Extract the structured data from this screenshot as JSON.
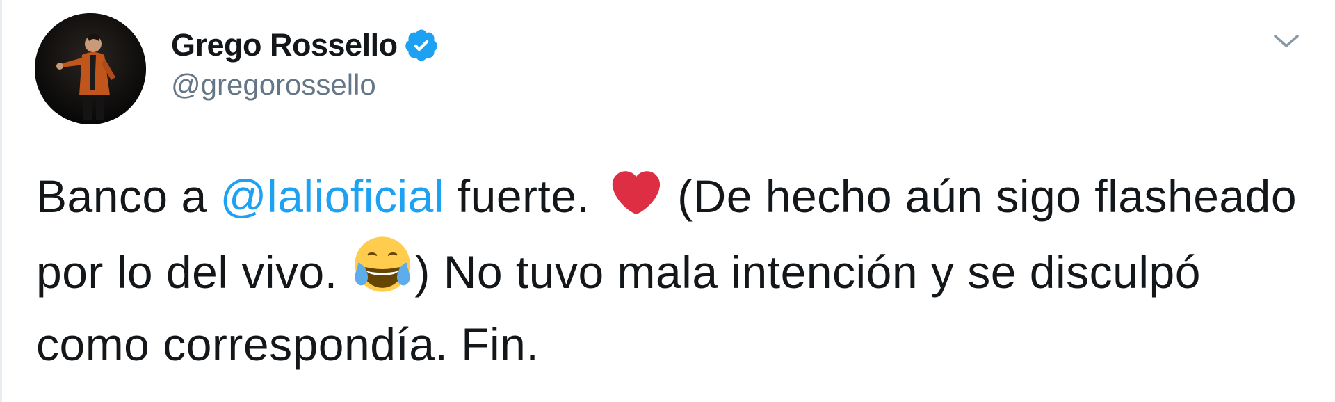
{
  "author": {
    "display_name": "Grego Rossello",
    "handle": "@gregorossello",
    "verified": true,
    "avatar_icon": "profile-photo"
  },
  "tweet": {
    "text_part1": "Banco a ",
    "mention": "@lalioficial",
    "text_part2": " fuerte. ",
    "emoji1": "red-heart",
    "text_part3": " (De hecho aún sigo flasheado por lo del vivo. ",
    "emoji2": "face-with-tears-of-joy",
    "text_part4": ") No tuvo mala intención y se disculpó como correspondía. Fin."
  },
  "colors": {
    "text": "#14171a",
    "secondary": "#657786",
    "link": "#1da1f2",
    "verified": "#1da1f2",
    "heart": "#dd2e44"
  },
  "icons": {
    "verified": "verified-badge-icon",
    "menu": "chevron-down-icon"
  }
}
